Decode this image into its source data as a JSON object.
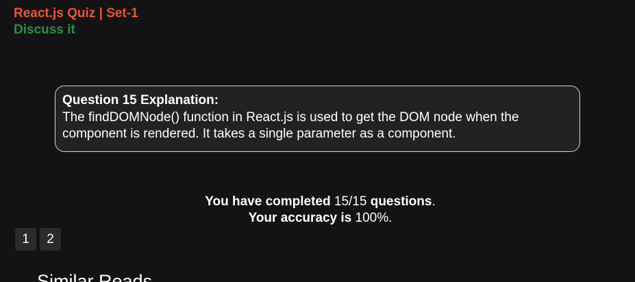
{
  "header": {
    "title": "React.js Quiz | Set-1",
    "discuss_link": "Discuss it"
  },
  "explanation": {
    "heading": "Question 15 Explanation:",
    "text": "The findDOMNode() function in React.js is used to get the DOM node when the component is rendered. It takes a single parameter as a component."
  },
  "result": {
    "completed_prefix": "You have completed",
    "completed_value": "15/15",
    "completed_suffix": "questions",
    "accuracy_prefix": "Your accuracy is",
    "accuracy_value": "100%"
  },
  "pagination": {
    "pages": [
      "1",
      "2"
    ]
  },
  "similar": {
    "heading": "Similar Reads"
  },
  "colors": {
    "title": "#ee5533",
    "discuss": "#2f8d46",
    "background": "#131316"
  }
}
